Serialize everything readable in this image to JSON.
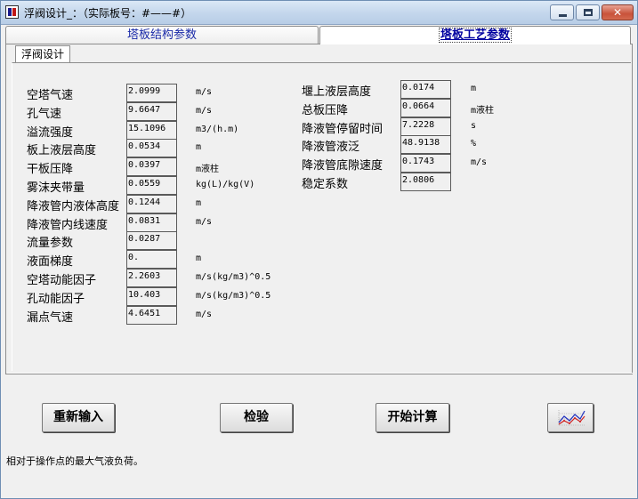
{
  "window": {
    "title": "浮阀设计_：（实际板号：#——#）",
    "close_glyph": "✕"
  },
  "tabs": [
    {
      "label": "塔板结构参数"
    },
    {
      "label": "塔板工艺参数"
    }
  ],
  "inner_tab": {
    "label": "浮阀设计"
  },
  "left_fields": [
    {
      "label": "空塔气速",
      "value": "2.0999",
      "unit": "m/s"
    },
    {
      "label": "孔气速",
      "value": "9.6647",
      "unit": "m/s"
    },
    {
      "label": "溢流强度",
      "value": "15.1096",
      "unit": "m3/(h.m)"
    },
    {
      "label": "板上液层高度",
      "value": "0.0534",
      "unit": "m"
    },
    {
      "label": "干板压降",
      "value": "0.0397",
      "unit": "m液柱"
    },
    {
      "label": "雾沫夹带量",
      "value": "0.0559",
      "unit": "kg(L)/kg(V)"
    },
    {
      "label": "降液管内液体高度",
      "value": "0.1244",
      "unit": "m"
    },
    {
      "label": "降液管内线速度",
      "value": "0.0831",
      "unit": "m/s"
    },
    {
      "label": "流量参数",
      "value": "0.0287",
      "unit": ""
    },
    {
      "label": "液面梯度",
      "value": "0.",
      "unit": "m"
    },
    {
      "label": "空塔动能因子",
      "value": "2.2603",
      "unit": "m/s(kg/m3)^0.5"
    },
    {
      "label": "孔动能因子",
      "value": "10.403",
      "unit": "m/s(kg/m3)^0.5"
    },
    {
      "label": "漏点气速",
      "value": "4.6451",
      "unit": "m/s"
    }
  ],
  "right_fields": [
    {
      "label": "堰上液层高度",
      "value": "0.0174",
      "unit": "m"
    },
    {
      "label": "总板压降",
      "value": "0.0664",
      "unit": "m液柱"
    },
    {
      "label": "降液管停留时间",
      "value": "7.2228",
      "unit": "s"
    },
    {
      "label": "降液管液泛",
      "value": "48.9138",
      "unit": "%"
    },
    {
      "label": "降液管底隙速度",
      "value": "0.1743",
      "unit": "m/s"
    },
    {
      "label": "稳定系数",
      "value": "2.0806",
      "unit": ""
    }
  ],
  "buttons": {
    "reinput": "重新输入",
    "check": "检验",
    "start": "开始计算",
    "chart_icon": "chart-icon"
  },
  "status_text": "相对于操作点的最大气液负荷。"
}
